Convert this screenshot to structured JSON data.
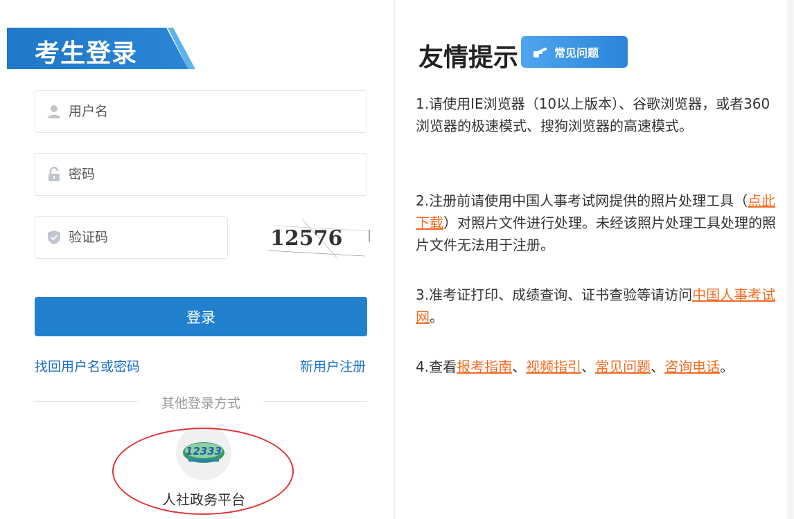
{
  "login": {
    "title": "考生登录",
    "username_placeholder": "用户名",
    "password_placeholder": "密码",
    "captcha_placeholder": "验证码",
    "captcha_text": "12576",
    "submit_label": "登录",
    "forgot_link": "找回用户名或密码",
    "register_link": "新用户注册",
    "other_methods_label": "其他登录方式",
    "platform_label": "人社政务平台",
    "platform_logo_text": "12333"
  },
  "tips": {
    "title": "友情提示",
    "faq_badge": "常见问题",
    "items": [
      {
        "text": "1.请使用IE浏览器（10以上版本）、谷歌浏览器，或者360浏览器的极速模式、搜狗浏览器的高速模式。"
      },
      {
        "prefix": "2.注册前请使用中国人事考试网提供的照片处理工具（",
        "link": "点此下载",
        "suffix": "）对照片文件进行处理。未经该照片处理工具处理的照片文件无法用于注册。"
      },
      {
        "prefix": "3.准考证打印、成绩查询、证书查验等请访问",
        "link": "中国人事考试网",
        "suffix": "。"
      },
      {
        "prefix": "4.查看",
        "links": [
          "报考指南",
          "视频指引",
          "常见问题",
          "咨询电话"
        ],
        "sep": "、",
        "suffix": "。"
      }
    ]
  },
  "colors": {
    "primary": "#2181cf",
    "link_blue": "#1b6fc2",
    "link_orange": "#f26b21",
    "highlight_ellipse": "#e03333"
  },
  "icons": {
    "username": "user-icon",
    "password": "lock-icon",
    "captcha": "shield-icon",
    "faq": "pointing-hand-icon"
  }
}
